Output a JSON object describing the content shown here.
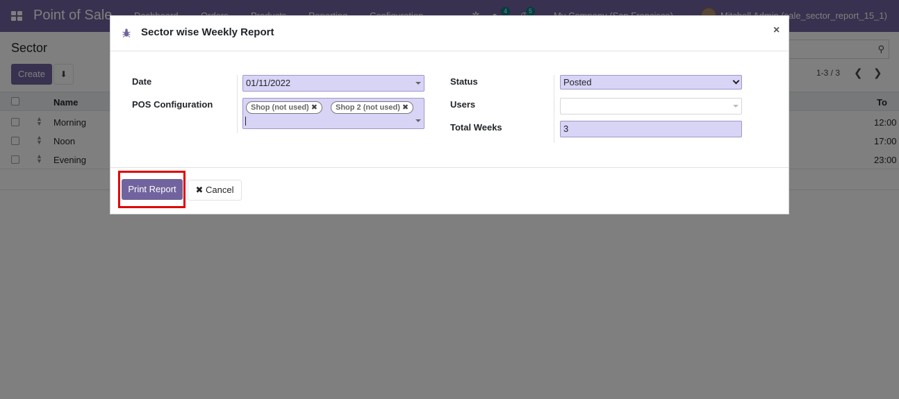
{
  "navbar": {
    "app_name": "Point of Sale",
    "menu": [
      "Dashboard",
      "Orders",
      "Products",
      "Reporting",
      "Configuration"
    ],
    "chat_badge": "4",
    "activity_badge": "5",
    "company": "My Company (San Francisco)",
    "user": "Mitchell Admin (sale_sector_report_15_1)"
  },
  "control_panel": {
    "breadcrumb": "Sector",
    "create_label": "Create",
    "pager": "1-3 / 3"
  },
  "list": {
    "columns": {
      "name": "Name",
      "to": "To"
    },
    "rows": [
      {
        "name": "Morning",
        "to": "12:00"
      },
      {
        "name": "Noon",
        "to": "17:00"
      },
      {
        "name": "Evening",
        "to": "23:00"
      }
    ]
  },
  "dialog": {
    "title": "Sector wise Weekly Report",
    "close": "×",
    "fields": {
      "date_label": "Date",
      "date_value": "01/11/2022",
      "pos_label": "POS Configuration",
      "pos_tags": [
        "Shop (not used)",
        "Shop 2 (not used)"
      ],
      "tag_remove": "✖",
      "status_label": "Status",
      "status_value": "Posted",
      "users_label": "Users",
      "users_value": "",
      "weeks_label": "Total Weeks",
      "weeks_value": "3"
    },
    "footer": {
      "print_label": "Print Report",
      "cancel_label": "Cancel",
      "cancel_icon": "✖"
    }
  },
  "colors": {
    "brand": "#71639e",
    "field_bg": "#d8d4f6",
    "highlight": "#e00000"
  }
}
